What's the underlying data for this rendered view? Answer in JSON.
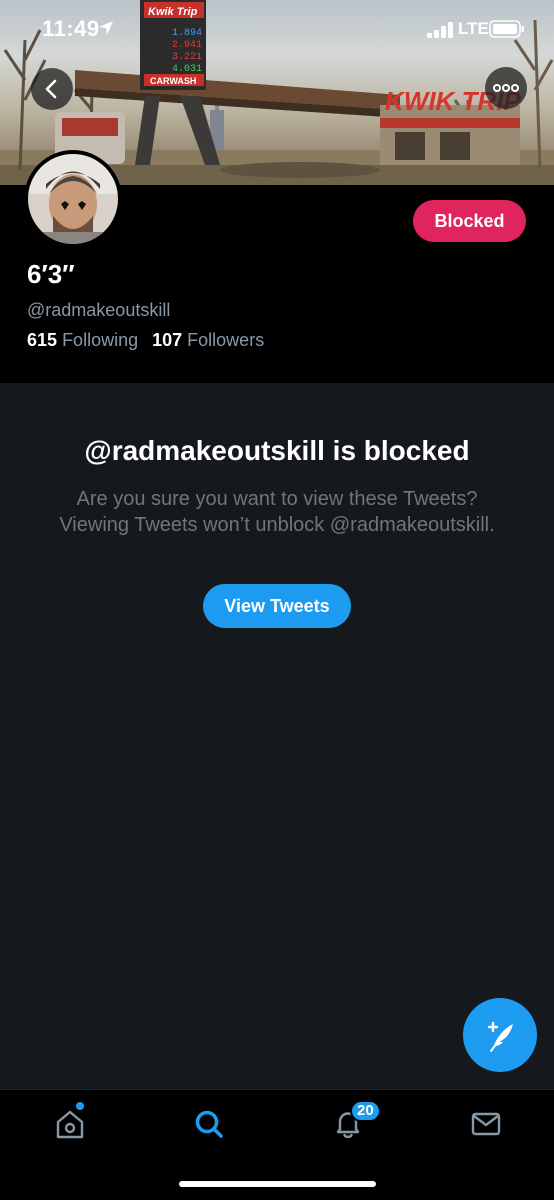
{
  "status_bar": {
    "time": "11:49",
    "network": "LTE"
  },
  "banner": {
    "sign_text": "KWIK TRIP",
    "price_sign_brand": "Kwik Trip",
    "prices": [
      "1.894",
      "2.941",
      "3.221",
      "4.031"
    ],
    "carwash_text": "CARWASH",
    "icons": [
      "back-arrow-icon",
      "more-dots-icon"
    ]
  },
  "profile": {
    "display_name": "6′3″",
    "handle": "@radmakeoutskill",
    "following_count": "615",
    "following_label": "Following",
    "followers_count": "107",
    "followers_label": "Followers",
    "blocked_button": "Blocked"
  },
  "main": {
    "blocked_title": "@radmakeoutskill is blocked",
    "blocked_description": "Are you sure you want to view these Tweets? Viewing Tweets won’t unblock @radmakeoutskill.",
    "view_tweets_button": "View Tweets"
  },
  "tab_bar": {
    "tabs": [
      "home-icon",
      "search-icon",
      "notifications-icon",
      "messages-icon"
    ],
    "notifications_badge": "20",
    "active_tab": "search"
  },
  "colors": {
    "accent": "#1d9bf0",
    "blocked": "#e0245e",
    "background": "#15181c",
    "muted_text": "#8899a6"
  }
}
